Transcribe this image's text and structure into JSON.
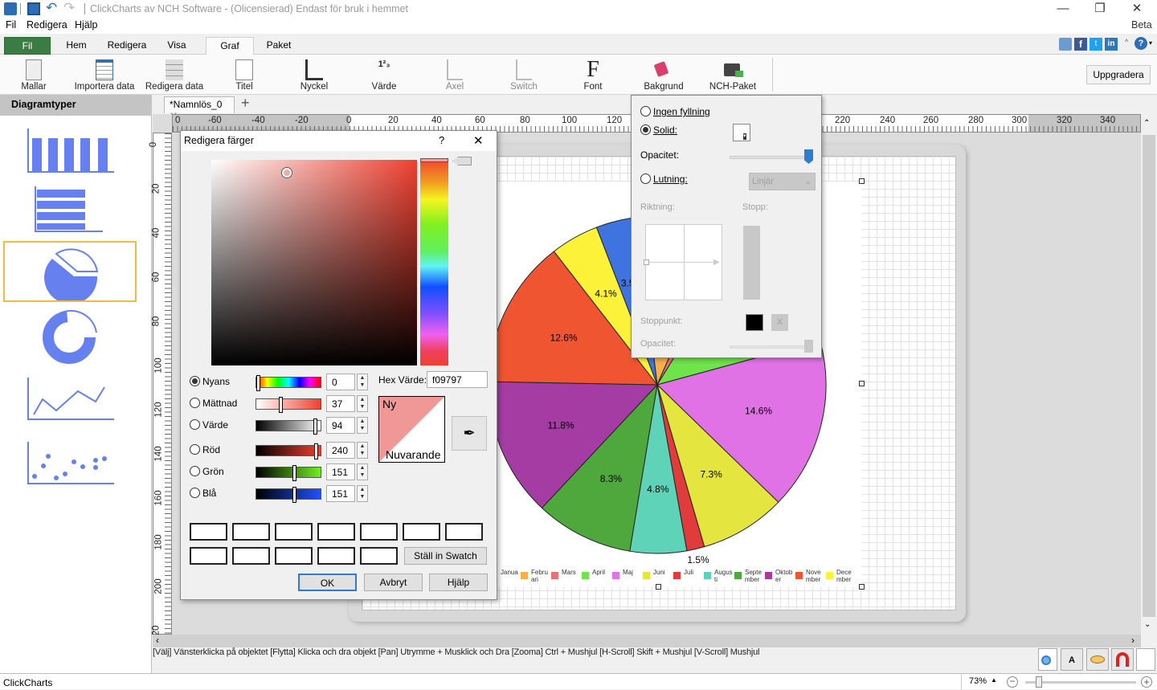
{
  "window": {
    "title": "ClickCharts av NCH Software - (Olicensierad) Endast för bruk i hemmet",
    "minimize": "—",
    "maximize": "❐",
    "close": "✕"
  },
  "menu": [
    "Fil",
    "Redigera",
    "Hjälp"
  ],
  "ribbon_tabs": [
    {
      "label": "Fil",
      "state": "file"
    },
    {
      "label": "Hem",
      "state": "normal"
    },
    {
      "label": "Redigera",
      "state": "normal"
    },
    {
      "label": "Visa",
      "state": "normal"
    },
    {
      "label": "Graf",
      "state": "active"
    },
    {
      "label": "Paket",
      "state": "normal"
    }
  ],
  "ribbon_buttons": [
    {
      "label": "Mallar",
      "icon": "templates-icon",
      "enabled": true
    },
    {
      "label": "Importera data",
      "icon": "import-data-icon",
      "enabled": true
    },
    {
      "label": "Redigera data",
      "icon": "edit-data-icon",
      "enabled": true
    },
    {
      "label": "Titel",
      "icon": "title-icon",
      "enabled": true
    },
    {
      "label": "Nyckel",
      "icon": "legend-icon",
      "enabled": true
    },
    {
      "label": "Värde",
      "icon": "value-icon",
      "enabled": true
    },
    {
      "label": "Axel",
      "icon": "axis-icon",
      "enabled": false
    },
    {
      "label": "Switch",
      "icon": "switch-icon",
      "enabled": false
    },
    {
      "label": "Font",
      "icon": "font-icon",
      "enabled": true
    },
    {
      "label": "Bakgrund",
      "icon": "background-fill-icon",
      "enabled": true
    },
    {
      "label": "NCH-Paket",
      "icon": "nch-suite-icon",
      "enabled": true
    }
  ],
  "upgrade_label": "Uppgradera",
  "beta_label": "Beta",
  "sidebar": {
    "title": "Diagramtyper",
    "types": [
      {
        "name": "column",
        "selected": false
      },
      {
        "name": "bar",
        "selected": false
      },
      {
        "name": "pie",
        "selected": true
      },
      {
        "name": "doughnut",
        "selected": false
      },
      {
        "name": "line",
        "selected": false
      },
      {
        "name": "scatter",
        "selected": false
      }
    ]
  },
  "document_tab": "*Namnlös_0",
  "ruler": {
    "h_labels": [
      "0",
      "-60",
      "-40",
      "-20",
      "0",
      "20",
      "40",
      "60",
      "80",
      "100",
      "120",
      "220",
      "240",
      "260",
      "280",
      "300",
      "320",
      "340"
    ],
    "v_labels": [
      "0",
      "20",
      "40",
      "60",
      "80",
      "100",
      "120",
      "140",
      "160",
      "180",
      "200",
      "20"
    ]
  },
  "color_dialog": {
    "title": "Redigera färger",
    "help": "?",
    "close": "✕",
    "rows": [
      {
        "label": "Nyans",
        "value": "0",
        "selected": true
      },
      {
        "label": "Mättnad",
        "value": "37",
        "selected": false
      },
      {
        "label": "Värde",
        "value": "94",
        "selected": false
      },
      {
        "label": "Röd",
        "value": "240",
        "selected": false
      },
      {
        "label": "Grön",
        "value": "151",
        "selected": false
      },
      {
        "label": "Blå",
        "value": "151",
        "selected": false
      }
    ],
    "hex_label": "Hex Värde:",
    "hex_value": "f09797",
    "new_label": "Ny",
    "current_label": "Nuvarande",
    "new_color": "#f09797",
    "current_color": "#ffffff",
    "set_swatch": "Ställ in Swatch",
    "ok": "OK",
    "cancel": "Avbryt",
    "help_button": "Hjälp"
  },
  "fill_popup": {
    "no_fill": "Ingen fyllning",
    "solid": "Solid:",
    "opacity": "Opacitet:",
    "gradient": "Lutning:",
    "gradient_type": "Linjär",
    "direction": "Riktning:",
    "stops": "Stopp:",
    "stop_point": "Stoppunkt:",
    "stop_remove": "X",
    "opacity2": "Opacitet:",
    "selected": "solid",
    "opacity_value": 1.0
  },
  "hint": "[Välj] Vänsterklicka på objektet [Flytta] Klicka och dra objekt [Pan] Utrymme + Musklick och Dra [Zooma] Ctrl + Mushjul [H-Scroll] Skift + Mushjul [V-Scroll] Mushjul",
  "status": {
    "app": "ClickCharts",
    "zoom": "73%",
    "zoom_fraction": 0.1
  },
  "chart_data": {
    "type": "pie",
    "title": "",
    "categories": [
      "Januari",
      "Februari",
      "Mars",
      "April",
      "Maj",
      "Juni",
      "Juli",
      "Augusti",
      "September",
      "Oktober",
      "November",
      "December"
    ],
    "legend_labels": [
      "Janua",
      "Febru ari",
      "Mars",
      "April",
      "Maj",
      "Juni",
      "Juli",
      "Augus ti",
      "Septe mber",
      "Oktob er",
      "Nove mber",
      "Dece mber"
    ],
    "values": [
      3.5,
      7.5,
      2.0,
      10.6,
      14.6,
      7.3,
      1.5,
      4.8,
      8.3,
      11.8,
      12.6,
      4.1
    ],
    "labels_visible": [
      "3.5%",
      "",
      "",
      "",
      "14.6%",
      "7.3%",
      "1.5%",
      "4.8%",
      "8.3%",
      "11.8%",
      "12.6%",
      "4.1%"
    ],
    "colors": [
      "#3f74e0",
      "#f4b04c",
      "#e57373",
      "#6ee34a",
      "#e172e6",
      "#e5e540",
      "#e03c3c",
      "#5ed3b7",
      "#4fa83c",
      "#a43ca4",
      "#ee5530",
      "#fdf23a"
    ],
    "legend": "bottom",
    "unit": "%"
  }
}
